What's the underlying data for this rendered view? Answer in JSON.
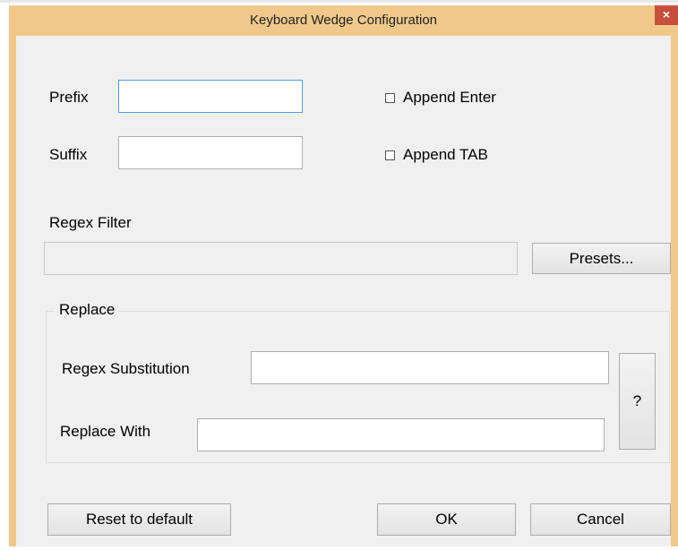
{
  "window": {
    "title": "Keyboard Wedge Configuration",
    "close_icon": "×"
  },
  "prefix": {
    "label": "Prefix",
    "value": ""
  },
  "suffix": {
    "label": "Suffix",
    "value": ""
  },
  "append_enter": {
    "label": "Append Enter",
    "checked": false,
    "icon": "☐"
  },
  "append_tab": {
    "label": "Append TAB",
    "checked": false,
    "icon": "☐"
  },
  "regex_filter": {
    "label": "Regex Filter",
    "value": ""
  },
  "presets_button": "Presets...",
  "replace_group": {
    "title": "Replace",
    "regex_substitution_label": "Regex Substitution",
    "regex_substitution_value": "",
    "replace_with_label": "Replace With",
    "replace_with_value": "",
    "help_button": "?"
  },
  "footer": {
    "reset_label": "Reset to default",
    "ok_label": "OK",
    "cancel_label": "Cancel"
  }
}
